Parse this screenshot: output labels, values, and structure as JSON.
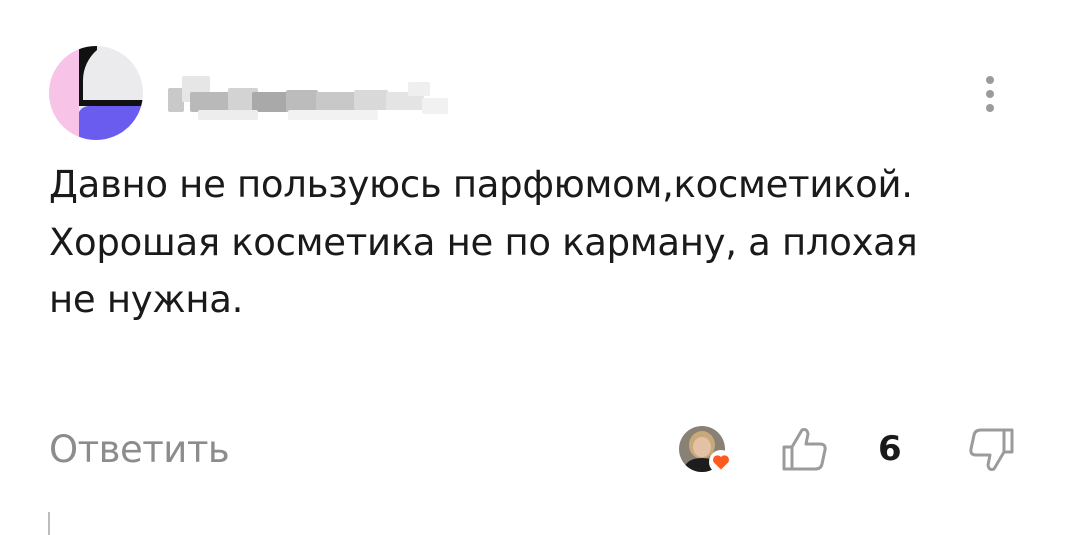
{
  "comment": {
    "text": "Давно не пользуюсь парфюмом,косметикой. Хорошая косметика не по карману, а плохая не нужна.",
    "reply_label": "Ответить",
    "like_count": "6"
  },
  "icons": {
    "menu": "more-vertical-icon",
    "like": "thumbs-up-icon",
    "dislike": "thumbs-down-icon",
    "reaction": "heart-icon"
  },
  "colors": {
    "text": "#1a1a1a",
    "muted": "#8c8c8c",
    "heart": "#ff5a1f",
    "avatar_pink": "#f7c4e8",
    "avatar_purple": "#6b5cf0"
  }
}
